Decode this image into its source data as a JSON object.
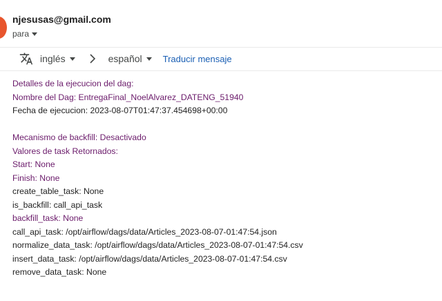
{
  "header": {
    "sender_email": "njesusas@gmail.com",
    "recipient_label": "para"
  },
  "translate": {
    "source_lang": "inglés",
    "target_lang": "español",
    "action_label": "Traducir mensaje",
    "icon": "translate-icon"
  },
  "body": {
    "purple_lines": [
      "Detalles de la ejecucion del dag:",
      "Nombre del Dag: EntregaFinal_NoelAlvarez_DATENG_51940"
    ],
    "execution_line": "Fecha de ejecucion: 2023-08-07T01:47:37.454698+00:00",
    "backfill_line": "Mecanismo de backfill: Desactivado",
    "tasks_header": "Valores de task Retornados:",
    "task_lines": [
      "Start: None",
      "Finish: None",
      "create_table_task: None",
      "is_backfill: call_api_task",
      "backfill_task: None",
      "call_api_task: /opt/airflow/dags/data/Articles_2023-08-07-01:47:54.json",
      "normalize_data_task: /opt/airflow/dags/data/Articles_2023-08-07-01:47:54.csv",
      "insert_data_task: /opt/airflow/dags/data/Articles_2023-08-07-01:47:54.csv",
      "remove_data_task: None"
    ]
  },
  "colors": {
    "purple_text": "#6a1a6a",
    "link": "#1a5fb4",
    "avatar": "#e8552d"
  }
}
